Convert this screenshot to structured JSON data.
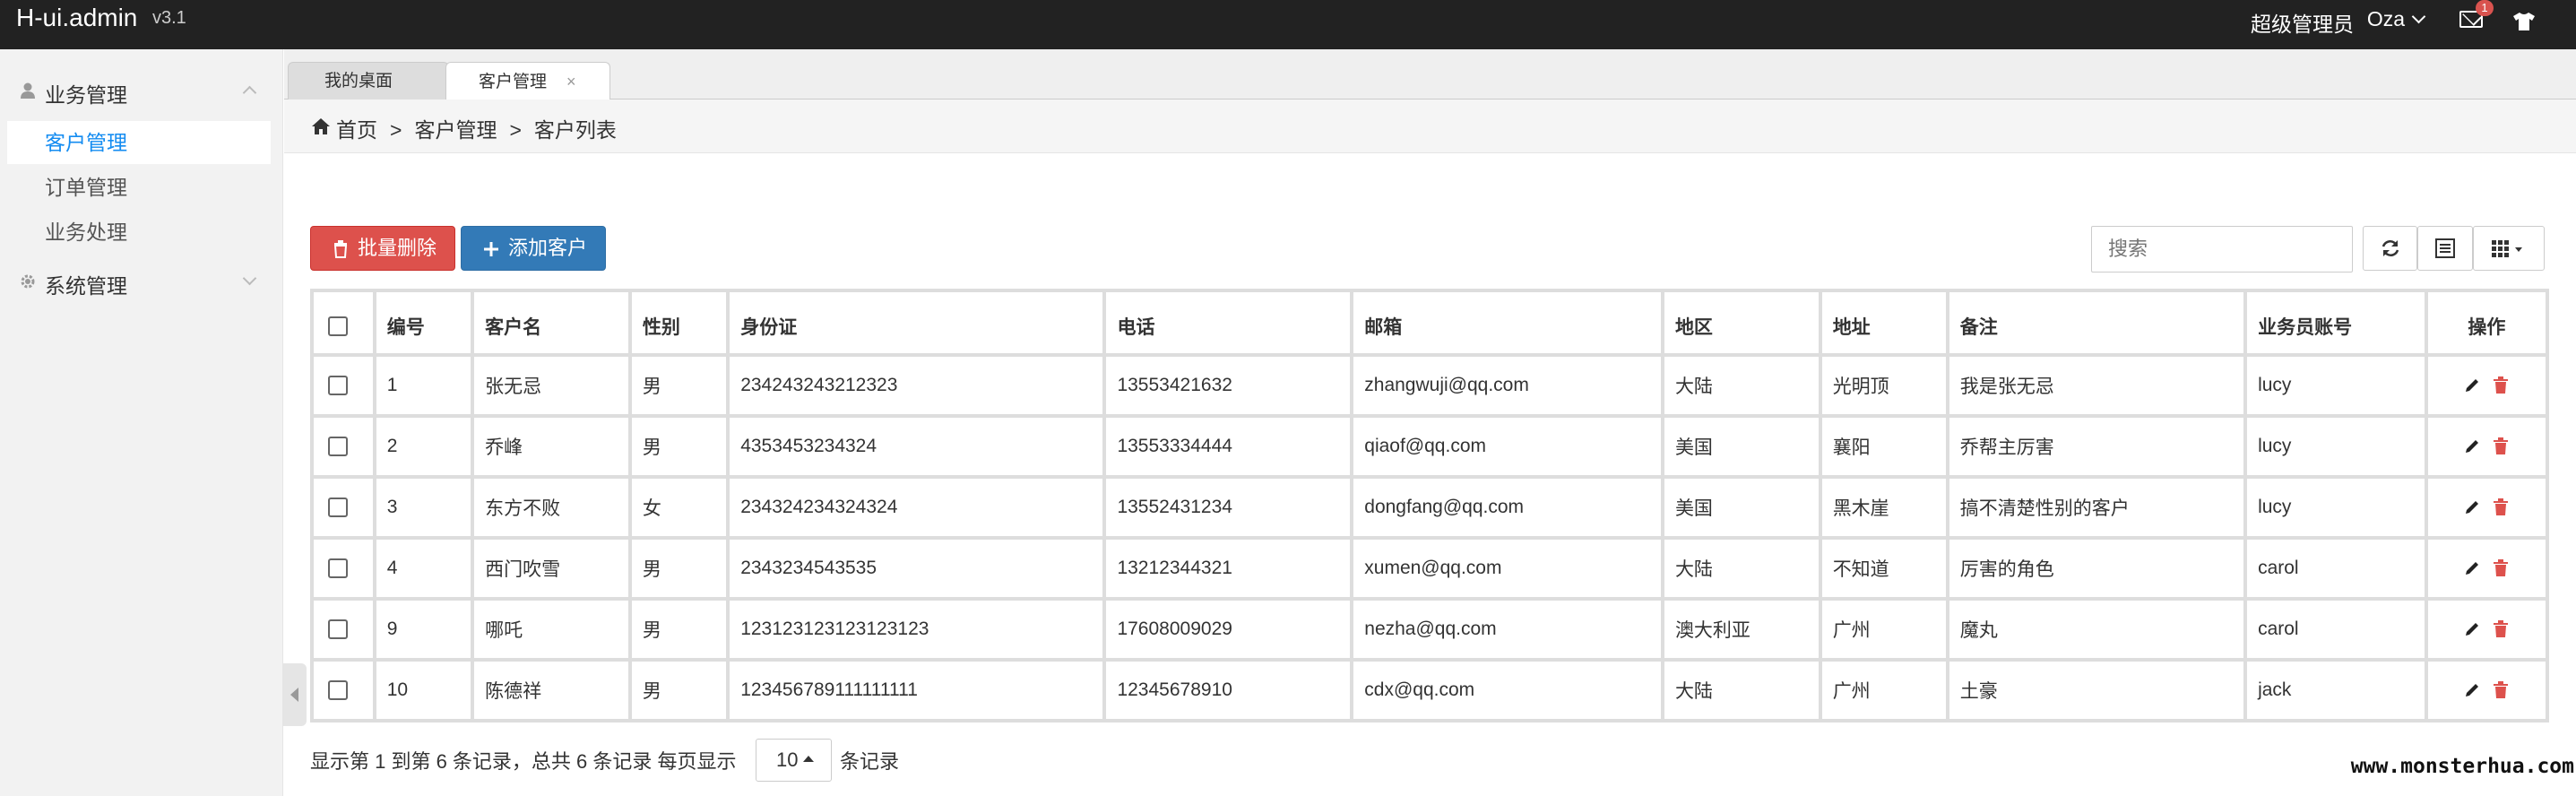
{
  "topbar": {
    "brand": "H-ui.admin",
    "version": "v3.1",
    "role": "超级管理员",
    "user": "Oza",
    "mail_badge": "1"
  },
  "sidebar": {
    "groups": [
      {
        "label": "业务管理",
        "expanded": true,
        "icon": "user-icon",
        "items": [
          {
            "label": "客户管理",
            "active": true
          },
          {
            "label": "订单管理"
          },
          {
            "label": "业务处理"
          }
        ]
      },
      {
        "label": "系统管理",
        "expanded": false,
        "icon": "gear-icon"
      }
    ]
  },
  "tabs": [
    {
      "label": "我的桌面",
      "active": false
    },
    {
      "label": "客户管理",
      "active": true,
      "close": "×"
    }
  ],
  "breadcrumb": {
    "items": [
      "首页",
      "客户管理",
      "客户列表"
    ],
    "separator": ">"
  },
  "toolbar": {
    "batch_delete": "批量删除",
    "add_customer": "添加客户",
    "search_placeholder": "搜索"
  },
  "table": {
    "headers": [
      "编号",
      "客户名",
      "性别",
      "身份证",
      "电话",
      "邮箱",
      "地区",
      "地址",
      "备注",
      "业务员账号",
      "操作"
    ],
    "rows": [
      [
        "1",
        "张无忌",
        "男",
        "234243243212323",
        "13553421632",
        "zhangwuji@qq.com",
        "大陆",
        "光明顶",
        "我是张无忌",
        "lucy"
      ],
      [
        "2",
        "乔峰",
        "男",
        "4353453234324",
        "13553334444",
        "qiaof@qq.com",
        "美国",
        "襄阳",
        "乔帮主厉害",
        "lucy"
      ],
      [
        "3",
        "东方不败",
        "女",
        "234324234324324",
        "13552431234",
        "dongfang@qq.com",
        "美国",
        "黑木崖",
        "搞不清楚性别的客户",
        "lucy"
      ],
      [
        "4",
        "西门吹雪",
        "男",
        "2343234543535",
        "13212344321",
        "xumen@qq.com",
        "大陆",
        "不知道",
        "厉害的角色",
        "carol"
      ],
      [
        "9",
        "哪吒",
        "男",
        "123123123123123123",
        "17608009029",
        "nezha@qq.com",
        "澳大利亚",
        "广州",
        "魔丸",
        "carol"
      ],
      [
        "10",
        "陈德祥",
        "男",
        "123456789111111111",
        "12345678910",
        "cdx@qq.com",
        "大陆",
        "广州",
        "土豪",
        "jack"
      ]
    ]
  },
  "footer": {
    "summary": "显示第 1 到第 6 条记录，总共 6 条记录  每页显示",
    "page_size": "10",
    "after": "条记录",
    "watermark": "www.monsterhua.com"
  },
  "colors": {
    "accent": "#148cf1",
    "danger": "#dd514c",
    "primary": "#337ab7",
    "topbar": "#222222"
  }
}
